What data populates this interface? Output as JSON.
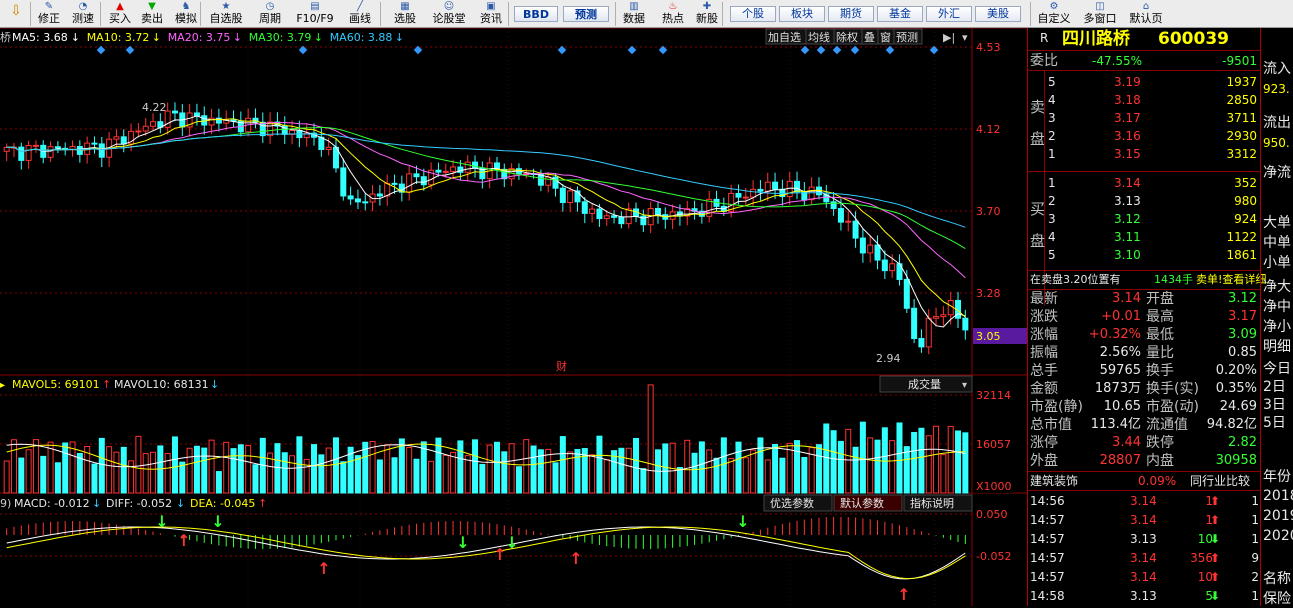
{
  "toolbar": {
    "items": [
      {
        "label": "修正",
        "icon": "edit-icon"
      },
      {
        "label": "测速",
        "icon": "speedtest-icon"
      },
      {
        "label": "买入",
        "icon": "buy-icon"
      },
      {
        "label": "卖出",
        "icon": "sell-icon"
      },
      {
        "label": "模拟",
        "icon": "simulate-icon"
      },
      {
        "label": "自选股",
        "icon": "watchlist-icon"
      },
      {
        "label": "周期",
        "icon": "period-icon"
      },
      {
        "label": "F10/F9",
        "icon": "f10-icon"
      },
      {
        "label": "画线",
        "icon": "draw-line-icon"
      },
      {
        "label": "选股",
        "icon": "stock-picker-icon"
      },
      {
        "label": "论股堂",
        "icon": "forum-icon"
      },
      {
        "label": "资讯",
        "icon": "news-icon"
      }
    ],
    "bbd": "BBD",
    "forecast": "预测",
    "items2": [
      {
        "label": "数据",
        "icon": "data-icon"
      },
      {
        "label": "热点",
        "icon": "hot-icon"
      },
      {
        "label": "新股",
        "icon": "new-stock-icon"
      }
    ],
    "tabs": [
      "个股",
      "板块",
      "期货",
      "基金",
      "外汇",
      "美股"
    ],
    "items3": [
      {
        "label": "自定义",
        "icon": "custom-icon"
      },
      {
        "label": "多窗口",
        "icon": "multiwindow-icon"
      },
      {
        "label": "默认页",
        "icon": "default-page-icon"
      }
    ]
  },
  "main_panel": {
    "ma_prefix": "桥",
    "ma": [
      {
        "label": "MA5: 3.68",
        "arrow": "↓",
        "color": "#ffffff"
      },
      {
        "label": "MA10: 3.72",
        "arrow": "↓",
        "color": "#ffff00"
      },
      {
        "label": "MA20: 3.75",
        "arrow": "↓",
        "color": "#ff66ff"
      },
      {
        "label": "MA30: 3.79",
        "arrow": "↓",
        "color": "#33ff33"
      },
      {
        "label": "MA60: 3.88",
        "arrow": "↓",
        "color": "#33ccff"
      }
    ],
    "buttons": [
      "加自选",
      "均线",
      "除权",
      "叠",
      "窗",
      "预测"
    ],
    "prices": [
      "4.53",
      "4.12",
      "3.70",
      "3.28"
    ],
    "current_price": "3.05",
    "high_label": "4.22",
    "low_label": "2.94",
    "cai": "财"
  },
  "volume_panel": {
    "mavol5": "MAVOL5: 69101",
    "mavol10": "MAVOL10: 68131",
    "dropdown": "成交量",
    "scale": [
      "32114",
      "16057"
    ],
    "unit": "X1000"
  },
  "macd_panel": {
    "prefix": "9)",
    "macd": "MACD: -0.012",
    "diff": "DIFF: -0.052",
    "dea": "DEA: -0.045",
    "tabs": [
      "优选参数",
      "默认参数",
      "指标说明"
    ],
    "scale": [
      "0.050",
      "-0.052"
    ]
  },
  "quote": {
    "code_prefix": "R",
    "name": "四川路桥",
    "code": "600039",
    "weibi_label": "委比",
    "weibi_pct": "-47.55%",
    "weibi_val": "-9501",
    "sell_label": [
      "卖",
      "盘"
    ],
    "sell": [
      {
        "n": "5",
        "p": "3.19",
        "v": "1937"
      },
      {
        "n": "4",
        "p": "3.18",
        "v": "2850"
      },
      {
        "n": "3",
        "p": "3.17",
        "v": "3711"
      },
      {
        "n": "2",
        "p": "3.16",
        "v": "2930"
      },
      {
        "n": "1",
        "p": "3.15",
        "v": "3312"
      }
    ],
    "buy_label": [
      "买",
      "盘"
    ],
    "buy": [
      {
        "n": "1",
        "p": "3.14",
        "v": "352",
        "c": "red"
      },
      {
        "n": "2",
        "p": "3.13",
        "v": "980",
        "c": "wht"
      },
      {
        "n": "3",
        "p": "3.12",
        "v": "924",
        "c": "grn"
      },
      {
        "n": "4",
        "p": "3.11",
        "v": "1122",
        "c": "grn"
      },
      {
        "n": "5",
        "p": "3.10",
        "v": "1861",
        "c": "grn"
      }
    ],
    "pending_a": "在卖盘3.20位置有",
    "pending_b": "1434手",
    "pending_c": "卖单!查看详细",
    "stats": [
      {
        "l1": "最新",
        "v1": "3.14",
        "c1": "red",
        "l2": "开盘",
        "v2": "3.12",
        "c2": "grn"
      },
      {
        "l1": "涨跌",
        "v1": "+0.01",
        "c1": "red",
        "l2": "最高",
        "v2": "3.17",
        "c2": "red"
      },
      {
        "l1": "涨幅",
        "v1": "+0.32%",
        "c1": "red",
        "l2": "最低",
        "v2": "3.09",
        "c2": "grn"
      },
      {
        "l1": "振幅",
        "v1": "2.56%",
        "c1": "wht",
        "l2": "量比",
        "v2": "0.85",
        "c2": "wht"
      },
      {
        "l1": "总手",
        "v1": "59765",
        "c1": "wht",
        "l2": "换手",
        "v2": "0.20%",
        "c2": "wht"
      },
      {
        "l1": "金额",
        "v1": "1873万",
        "c1": "wht",
        "l2": "换手(实)",
        "v2": "0.35%",
        "c2": "wht"
      },
      {
        "l1": "市盈(静)",
        "v1": "10.65",
        "c1": "wht",
        "l2": "市盈(动)",
        "v2": "24.69",
        "c2": "wht"
      },
      {
        "l1": "总市值",
        "v1": "113.4亿",
        "c1": "wht",
        "l2": "流通值",
        "v2": "94.82亿",
        "c2": "wht"
      },
      {
        "l1": "涨停",
        "v1": "3.44",
        "c1": "red",
        "l2": "跌停",
        "v2": "2.82",
        "c2": "grn"
      },
      {
        "l1": "外盘",
        "v1": "28807",
        "c1": "red",
        "l2": "内盘",
        "v2": "30958",
        "c2": "grn"
      }
    ],
    "industry": "建筑装饰",
    "industry_pct": "0.09%",
    "peer": "同行业比较",
    "ticks": [
      {
        "t": "14:56",
        "p": "3.14",
        "pc": "red",
        "v": "1",
        "d": "up",
        "n": "1"
      },
      {
        "t": "14:57",
        "p": "3.14",
        "pc": "red",
        "v": "1",
        "d": "up",
        "n": "1"
      },
      {
        "t": "14:57",
        "p": "3.13",
        "pc": "wht",
        "v": "10",
        "d": "down",
        "n": "1"
      },
      {
        "t": "14:57",
        "p": "3.14",
        "pc": "red",
        "v": "356",
        "d": "up",
        "n": "9"
      },
      {
        "t": "14:57",
        "p": "3.14",
        "pc": "red",
        "v": "10",
        "d": "up",
        "n": "2"
      },
      {
        "t": "14:58",
        "p": "3.13",
        "pc": "wht",
        "v": "5",
        "d": "down",
        "n": "1"
      }
    ]
  },
  "far_right": {
    "labels": [
      "流入",
      "923.",
      "流出",
      "950.",
      "净流",
      "大单",
      "中单",
      "小单",
      "净大",
      "净中",
      "净小",
      "明细",
      "今日",
      "2日",
      "3日",
      "5日",
      "年份",
      "2018",
      "2019",
      "2020",
      "名称",
      "保险"
    ]
  },
  "colors": {
    "up": "#ff3333",
    "down": "#33ffff",
    "grid": "#8a0000"
  }
}
